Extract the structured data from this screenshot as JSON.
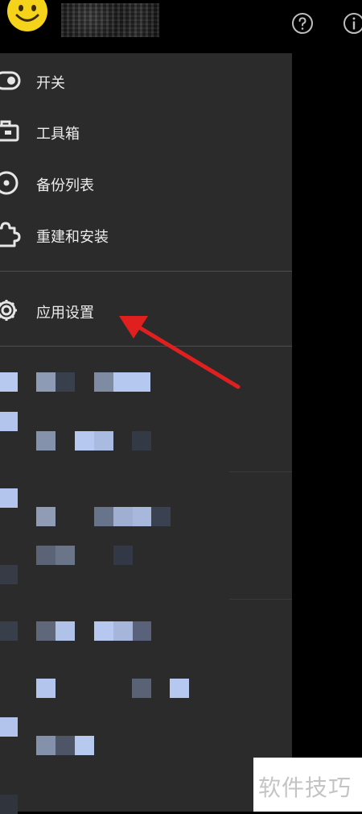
{
  "header": {
    "account_name": "",
    "icons": [
      "smiley-avatar-icon",
      "help-icon",
      "info-icon"
    ]
  },
  "drawer": {
    "items": [
      {
        "label": "开关",
        "icon": "toggle-switch-icon"
      },
      {
        "label": "工具箱",
        "icon": "toolbox-icon"
      },
      {
        "label": "备份列表",
        "icon": "disc-icon"
      },
      {
        "label": "重建和安装",
        "icon": "puzzle-icon"
      },
      {
        "label": "应用设置",
        "icon": "gear-icon"
      }
    ]
  },
  "annotation": {
    "type": "red-arrow",
    "points_to": "应用设置"
  },
  "watermark": {
    "text": "软件技巧"
  },
  "colors": {
    "drawer_bg": "#2b2b2b",
    "top_bg": "#000000",
    "arrow": "#e0201f",
    "pixel_blue": "#b8cbef"
  }
}
